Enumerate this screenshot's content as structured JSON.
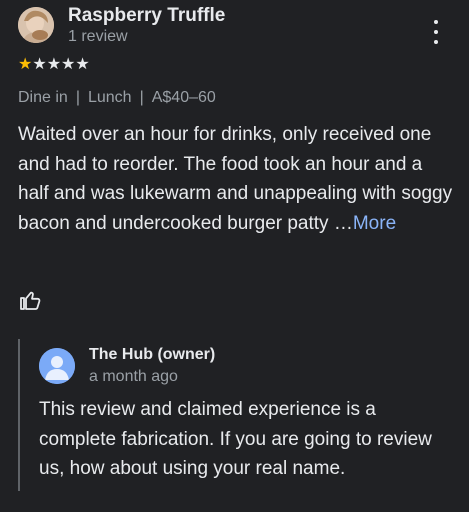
{
  "review": {
    "author": "Raspberry Truffle",
    "review_count": "1 review",
    "rating": 1,
    "stars_total": 5,
    "meta": [
      "Dine in",
      "Lunch",
      "A$40–60"
    ],
    "text": "Waited over an hour for drinks, only received one and had to reorder. The food took an hour and a half and was lukewarm and unappealing with soggy bacon and undercooked burger patty",
    "ellipsis": "…",
    "more_label": "More"
  },
  "owner_reply": {
    "name": "The Hub (owner)",
    "time": "a month ago",
    "text": "This review and claimed experience is a complete fabrication. If you are going to review us, how about using your real name."
  },
  "colors": {
    "background": "#202124",
    "star": "#fbbc04",
    "link": "#8ab4f8",
    "owner_avatar": "#7baaf7"
  },
  "icons": {
    "menu": "more-vert-icon",
    "like": "thumb-up-icon",
    "owner_avatar": "person-icon"
  }
}
